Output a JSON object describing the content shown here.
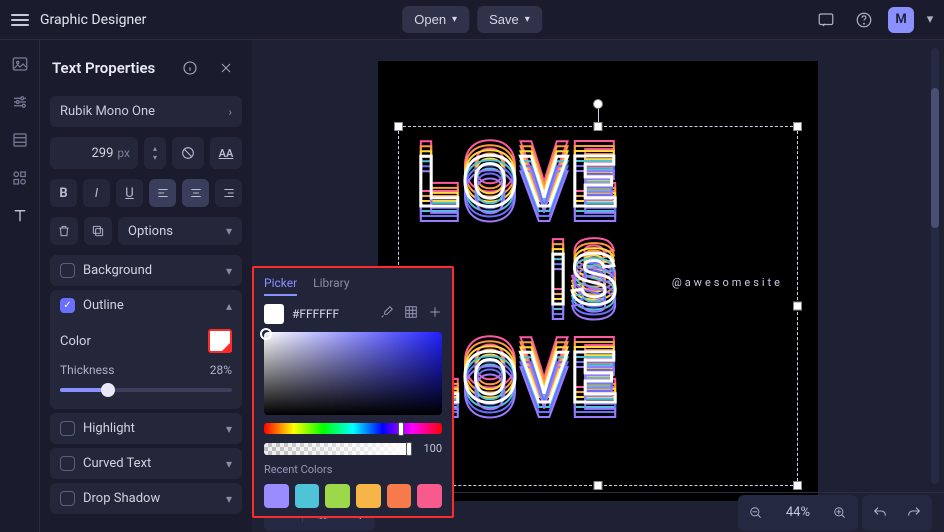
{
  "app_title": "Graphic Designer",
  "top_buttons": {
    "open": "Open",
    "save": "Save"
  },
  "avatar_initial": "M",
  "panel": {
    "title": "Text Properties",
    "font": "Rubik Mono One",
    "size": "299",
    "size_unit": "px",
    "options": "Options"
  },
  "sections": {
    "background": "Background",
    "outline": "Outline",
    "highlight": "Highlight",
    "curved": "Curved Text",
    "shadow": "Drop Shadow"
  },
  "outline": {
    "color_label": "Color",
    "thickness_label": "Thickness",
    "thickness_pct": "28%",
    "thickness_val": 28
  },
  "picker": {
    "tab_picker": "Picker",
    "tab_library": "Library",
    "hex": "#FFFFFF",
    "alpha": "100",
    "recent_label": "Recent Colors",
    "recent": [
      "#9a8cff",
      "#4fc4d9",
      "#9dd84a",
      "#f7b547",
      "#f77a4a",
      "#f75a8c"
    ]
  },
  "canvas": {
    "line1": "LOVE",
    "line2": "IS",
    "line3": "LOVE",
    "watermark": "@awesomesite"
  },
  "zoom": "44%"
}
